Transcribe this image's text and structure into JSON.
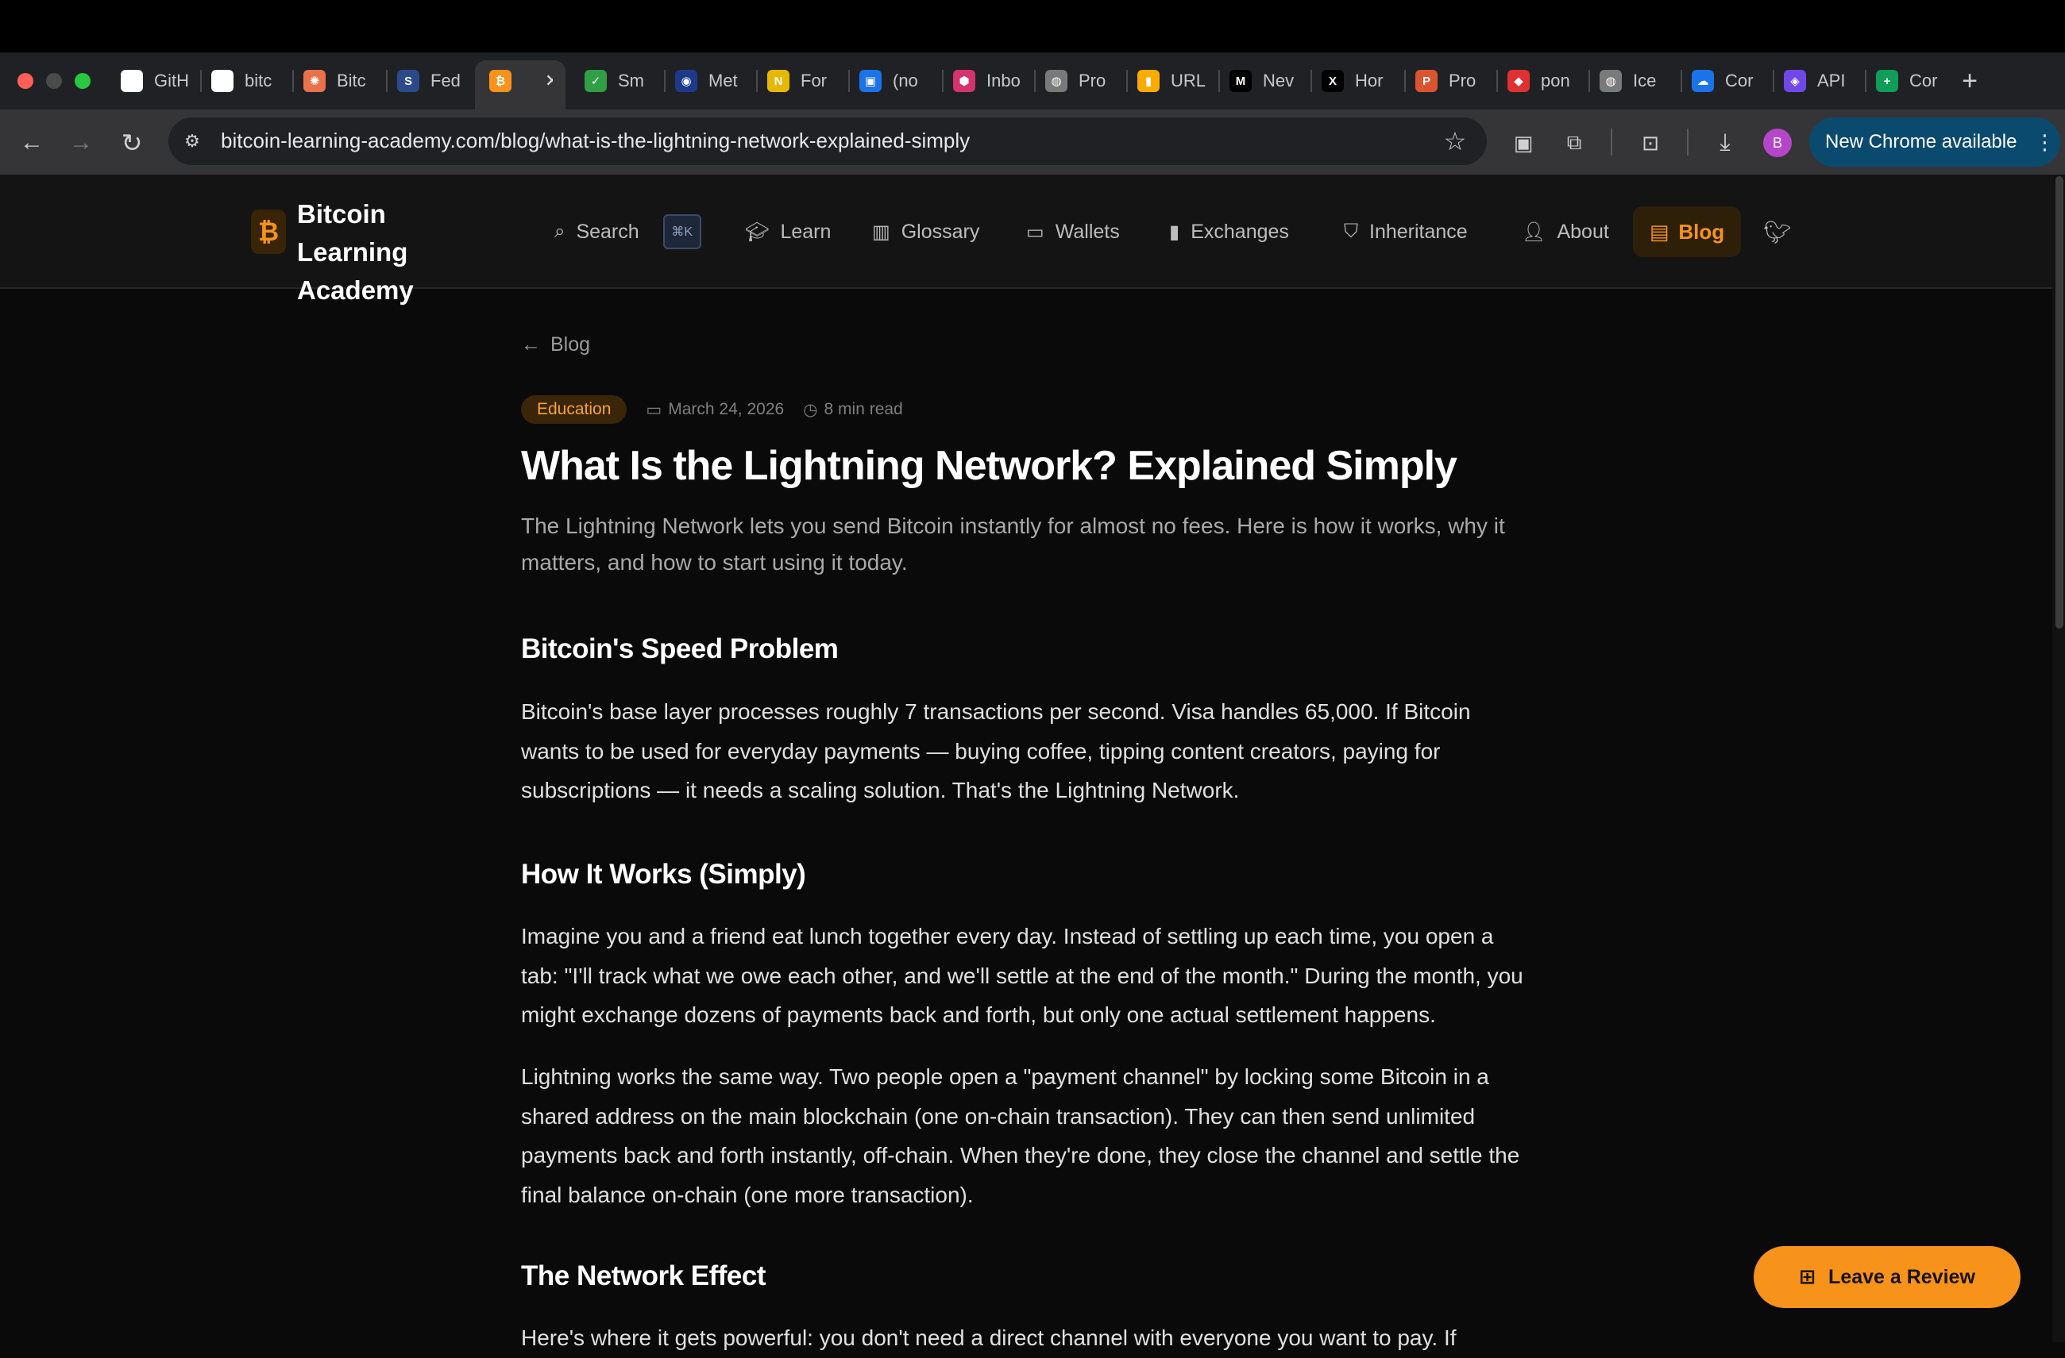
{
  "browser": {
    "tabs": [
      {
        "label": "GitH",
        "icon": "github-icon",
        "color": "#ffffff"
      },
      {
        "label": "bitc",
        "icon": "triangle-icon",
        "color": "#ffffff"
      },
      {
        "label": "Bitc",
        "icon": "sparkle-icon",
        "color": "#e8734a"
      },
      {
        "label": "Fed",
        "icon": "sba-icon",
        "color": "#2b4a8a"
      },
      {
        "label": "",
        "icon": "bitcoin-icon",
        "color": "#f7931a"
      },
      {
        "label": "Sm",
        "icon": "shield-check-icon",
        "color": "#2f9e44"
      },
      {
        "label": "Met",
        "icon": "meta-icon",
        "color": "#1d3a8a"
      },
      {
        "label": "For",
        "icon": "n-icon",
        "color": "#e6b800"
      },
      {
        "label": "(no",
        "icon": "inbox-icon",
        "color": "#1a73e8"
      },
      {
        "label": "Inbo",
        "icon": "hexagon-icon",
        "color": "#d6336c"
      },
      {
        "label": "Pro",
        "icon": "globe-icon",
        "color": "#7a7a7a"
      },
      {
        "label": "URL",
        "icon": "analytics-icon",
        "color": "#f9ab00"
      },
      {
        "label": "Nev",
        "icon": "mc-icon",
        "color": "#000000"
      },
      {
        "label": "Hor",
        "icon": "x-logo-icon",
        "color": "#000000"
      },
      {
        "label": "Pro",
        "icon": "producthunt-icon",
        "color": "#da552f"
      },
      {
        "label": "pon",
        "icon": "pon-icon",
        "color": "#e03131"
      },
      {
        "label": "Ice",
        "icon": "globe-icon",
        "color": "#7a7a7a"
      },
      {
        "label": "Cor",
        "icon": "cloud-icon",
        "color": "#1a73e8"
      },
      {
        "label": "API",
        "icon": "api-icon",
        "color": "#7048e8"
      },
      {
        "label": "Cor",
        "icon": "sheets-icon",
        "color": "#0f9d58"
      }
    ],
    "url": "bitcoin-learning-academy.com/blog/what-is-the-lightning-network-explained-simply",
    "profile_initial": "B",
    "update_label": "New Chrome available"
  },
  "site": {
    "brand": "Bitcoin Learning Academy",
    "logo_glyph": "₿",
    "accent": "#f7931a",
    "nav": {
      "search": "Search",
      "shortcut": "⌘K",
      "learn": "Learn",
      "glossary": "Glossary",
      "wallets": "Wallets",
      "exchanges": "Exchanges",
      "inheritance": "Inheritance",
      "about": "About",
      "blog": "Blog"
    }
  },
  "article": {
    "back_label": "Blog",
    "category": "Education",
    "date": "March 24, 2026",
    "read_time": "8 min read",
    "title": "What Is the Lightning Network? Explained Simply",
    "subtitle": "The Lightning Network lets you send Bitcoin instantly for almost no fees. Here is how it works, why it matters, and how to start using it today.",
    "sections": [
      {
        "heading": "Bitcoin's Speed Problem",
        "paragraphs": [
          "Bitcoin's base layer processes roughly 7 transactions per second. Visa handles 65,000. If Bitcoin wants to be used for everyday payments — buying coffee, tipping content creators, paying for subscriptions — it needs a scaling solution. That's the Lightning Network."
        ]
      },
      {
        "heading": "How It Works (Simply)",
        "paragraphs": [
          "Imagine you and a friend eat lunch together every day. Instead of settling up each time, you open a tab: \"I'll track what we owe each other, and we'll settle at the end of the month.\" During the month, you might exchange dozens of payments back and forth, but only one actual settlement happens.",
          "Lightning works the same way. Two people open a \"payment channel\" by locking some Bitcoin in a shared address on the main blockchain (one on-chain transaction). They can then send unlimited payments back and forth instantly, off-chain. When they're done, they close the channel and settle the final balance on-chain (one more transaction)."
        ]
      },
      {
        "heading": "The Network Effect",
        "paragraphs": [
          "Here's where it gets powerful: you don't need a direct channel with everyone you want to pay. If"
        ]
      }
    ]
  },
  "review_button": "Leave a Review"
}
